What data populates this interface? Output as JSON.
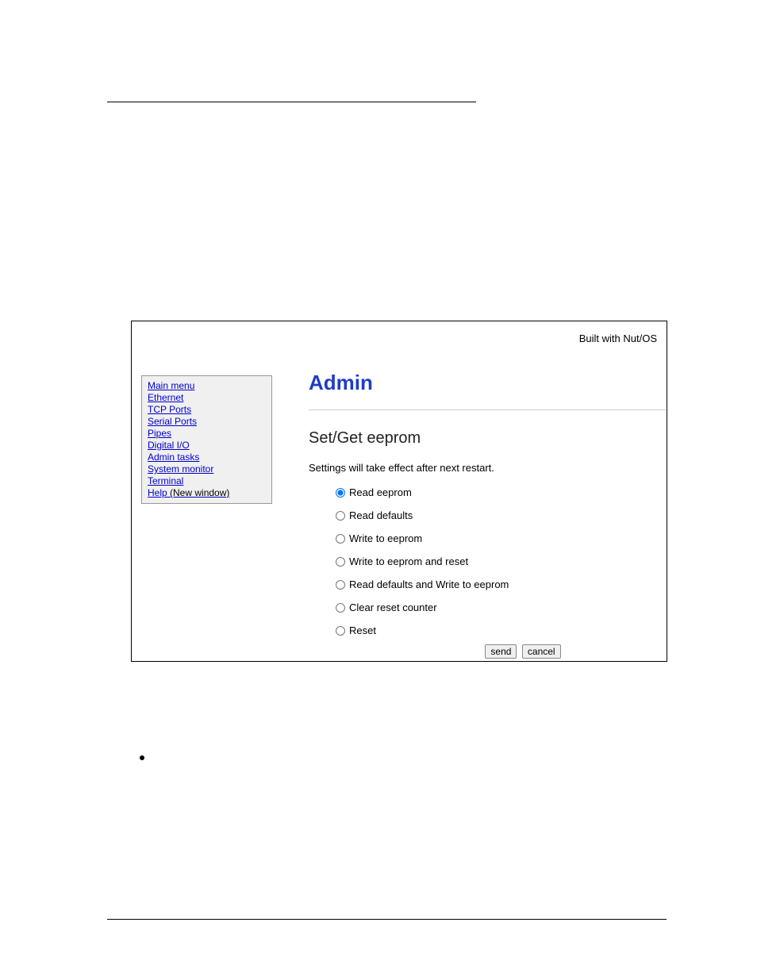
{
  "header": {
    "built_with": "Built with Nut/OS"
  },
  "sidebar": {
    "items": [
      {
        "label": "Main menu"
      },
      {
        "label": "Ethernet"
      },
      {
        "label": "TCP Ports"
      },
      {
        "label": "Serial Ports"
      },
      {
        "label": "Pipes"
      },
      {
        "label": "Digital I/O"
      },
      {
        "label": "Admin tasks"
      },
      {
        "label": "System monitor"
      },
      {
        "label": "Terminal"
      }
    ],
    "help_label": "Help",
    "help_suffix": " (New window)"
  },
  "main": {
    "title": "Admin",
    "subtitle": "Set/Get eeprom",
    "description": "Settings will take effect after next restart.",
    "options": [
      {
        "label": "Read eeprom",
        "checked": true
      },
      {
        "label": "Read defaults",
        "checked": false
      },
      {
        "label": "Write to eeprom",
        "checked": false
      },
      {
        "label": "Write to eeprom and reset",
        "checked": false
      },
      {
        "label": "Read defaults and Write to eeprom",
        "checked": false
      },
      {
        "label": "Clear reset counter",
        "checked": false
      },
      {
        "label": "Reset",
        "checked": false
      }
    ],
    "buttons": {
      "send": "send",
      "cancel": "cancel"
    }
  }
}
